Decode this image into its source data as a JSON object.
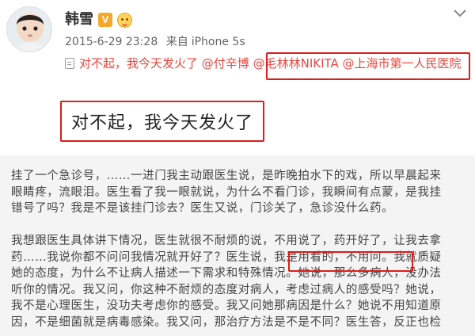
{
  "post": {
    "author": "韩雪",
    "verified_badge": "V",
    "timestamp": "2015-6-29 23:28",
    "source_prefix": "来自",
    "device": "iPhone 5s"
  },
  "repost": {
    "text": "对不起，我今天发火了",
    "mention_1": "@付辛博",
    "mention_2": "@毛林林NIKITA",
    "mention_3": "@上海市第一人民医院"
  },
  "quote": {
    "text": "对不起，我今天发火了"
  },
  "body": {
    "paragraph_1": [
      "挂了一个急诊号，……一进门我主动跟医生说，是昨晚拍水下的戏，所以早晨起来",
      "眼睛疼，流眼泪。医生看了我一眼就说，为什么不看门诊，我瞬间有点蒙，是我挂",
      "错号了吗？我是不是该挂门诊去？医生又说，门诊关了，急诊没什么药。"
    ],
    "paragraph_2": [
      "我想跟医生具体讲下情况，医生就很不耐烦的说，不用说了，药开好了，让我去拿",
      "药……我说你都不问问我情况就开好了？医生说，我是用看的，不用问。我就质疑",
      "她的态度，为什么不让病人描述一下需求和特殊情况。她说，那么多病人，没办法",
      "听你的情况。我又问，你这种不耐烦的态度对病人，考虑过病人的感受吗？她说，",
      "我不是心理医生，没功夫考虑你的感受。我又问她那病因是什么？她说不用知道原",
      "因，不是细菌就是病毒感染。我又问，那治疗方法是不是不同？医生答，反正也检"
    ]
  },
  "colors": {
    "accent_red": "#e01b1b",
    "mention_red": "#e8463f",
    "verified_orange": "#f7a829"
  },
  "icons": [
    "avatar-photo",
    "verified-v-icon",
    "emoji-badge-icon",
    "chevron-down-icon",
    "document-icon"
  ]
}
